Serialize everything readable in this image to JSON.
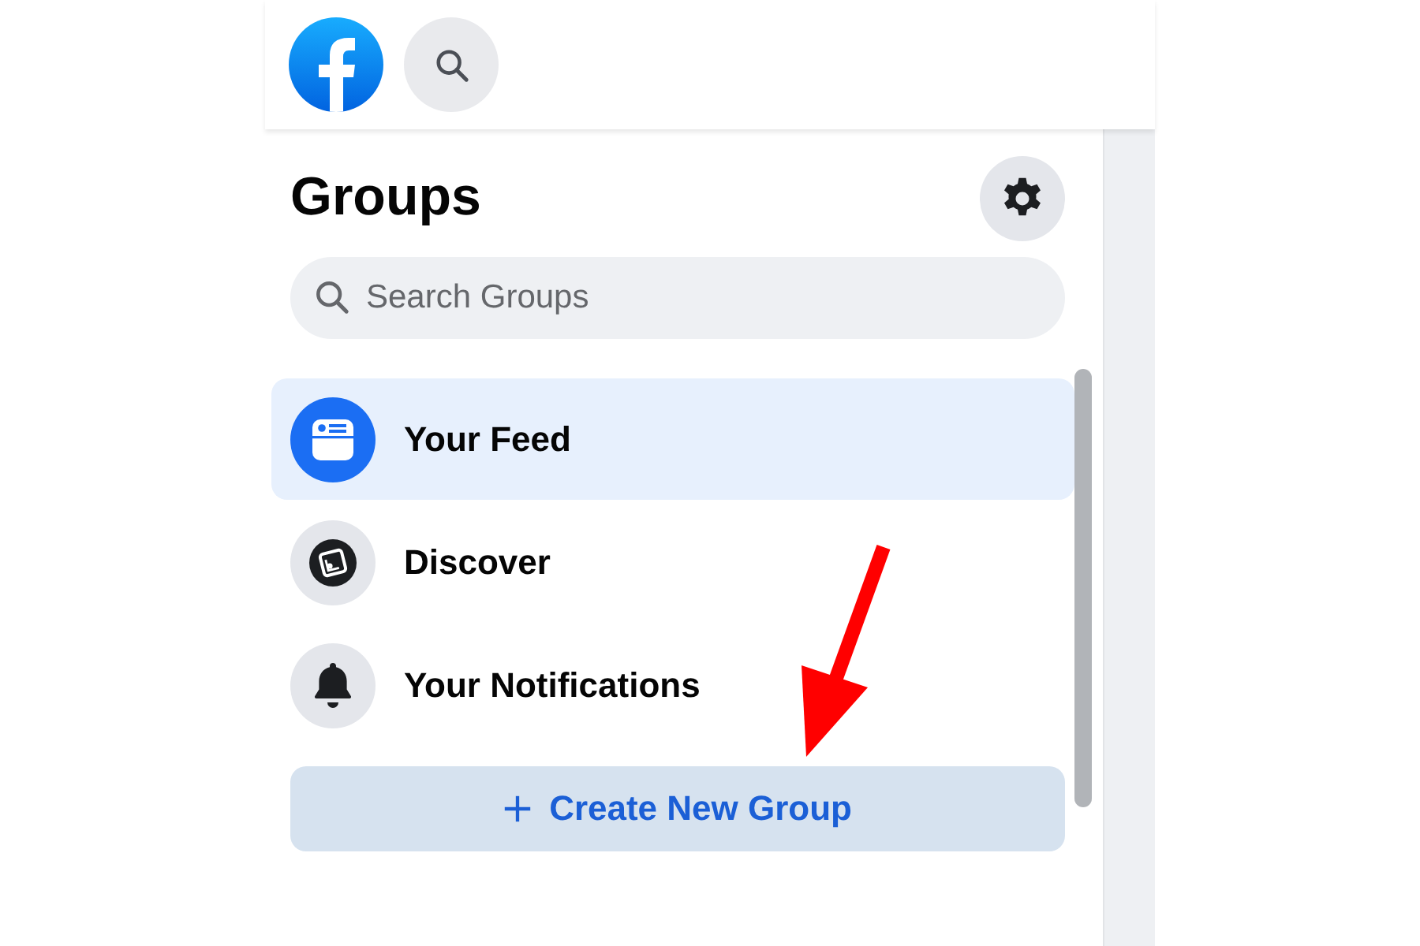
{
  "title": "Groups",
  "search": {
    "placeholder": "Search Groups"
  },
  "nav_items": [
    {
      "label": "Your Feed",
      "kind": "feed",
      "selected": true
    },
    {
      "label": "Discover",
      "kind": "discover",
      "selected": false
    },
    {
      "label": "Your Notifications",
      "kind": "notifications",
      "selected": false
    }
  ],
  "create_button": {
    "label": "Create New Group"
  }
}
